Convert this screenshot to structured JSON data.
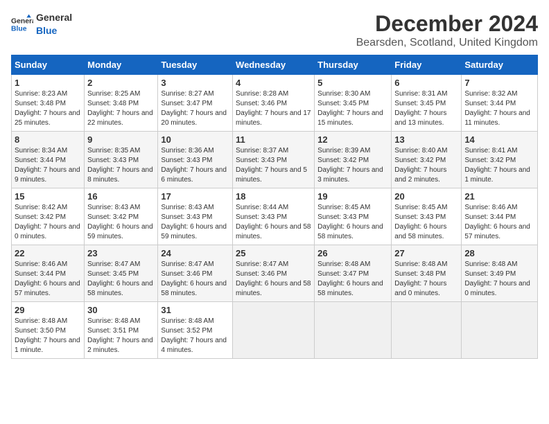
{
  "header": {
    "logo_general": "General",
    "logo_blue": "Blue",
    "title": "December 2024",
    "subtitle": "Bearsden, Scotland, United Kingdom"
  },
  "days_of_week": [
    "Sunday",
    "Monday",
    "Tuesday",
    "Wednesday",
    "Thursday",
    "Friday",
    "Saturday"
  ],
  "weeks": [
    [
      {
        "num": "1",
        "sunrise": "8:23 AM",
        "sunset": "3:48 PM",
        "daylight": "7 hours and 25 minutes."
      },
      {
        "num": "2",
        "sunrise": "8:25 AM",
        "sunset": "3:48 PM",
        "daylight": "7 hours and 22 minutes."
      },
      {
        "num": "3",
        "sunrise": "8:27 AM",
        "sunset": "3:47 PM",
        "daylight": "7 hours and 20 minutes."
      },
      {
        "num": "4",
        "sunrise": "8:28 AM",
        "sunset": "3:46 PM",
        "daylight": "7 hours and 17 minutes."
      },
      {
        "num": "5",
        "sunrise": "8:30 AM",
        "sunset": "3:45 PM",
        "daylight": "7 hours and 15 minutes."
      },
      {
        "num": "6",
        "sunrise": "8:31 AM",
        "sunset": "3:45 PM",
        "daylight": "7 hours and 13 minutes."
      },
      {
        "num": "7",
        "sunrise": "8:32 AM",
        "sunset": "3:44 PM",
        "daylight": "7 hours and 11 minutes."
      }
    ],
    [
      {
        "num": "8",
        "sunrise": "8:34 AM",
        "sunset": "3:44 PM",
        "daylight": "7 hours and 9 minutes."
      },
      {
        "num": "9",
        "sunrise": "8:35 AM",
        "sunset": "3:43 PM",
        "daylight": "7 hours and 8 minutes."
      },
      {
        "num": "10",
        "sunrise": "8:36 AM",
        "sunset": "3:43 PM",
        "daylight": "7 hours and 6 minutes."
      },
      {
        "num": "11",
        "sunrise": "8:37 AM",
        "sunset": "3:43 PM",
        "daylight": "7 hours and 5 minutes."
      },
      {
        "num": "12",
        "sunrise": "8:39 AM",
        "sunset": "3:42 PM",
        "daylight": "7 hours and 3 minutes."
      },
      {
        "num": "13",
        "sunrise": "8:40 AM",
        "sunset": "3:42 PM",
        "daylight": "7 hours and 2 minutes."
      },
      {
        "num": "14",
        "sunrise": "8:41 AM",
        "sunset": "3:42 PM",
        "daylight": "7 hours and 1 minute."
      }
    ],
    [
      {
        "num": "15",
        "sunrise": "8:42 AM",
        "sunset": "3:42 PM",
        "daylight": "7 hours and 0 minutes."
      },
      {
        "num": "16",
        "sunrise": "8:43 AM",
        "sunset": "3:42 PM",
        "daylight": "6 hours and 59 minutes."
      },
      {
        "num": "17",
        "sunrise": "8:43 AM",
        "sunset": "3:43 PM",
        "daylight": "6 hours and 59 minutes."
      },
      {
        "num": "18",
        "sunrise": "8:44 AM",
        "sunset": "3:43 PM",
        "daylight": "6 hours and 58 minutes."
      },
      {
        "num": "19",
        "sunrise": "8:45 AM",
        "sunset": "3:43 PM",
        "daylight": "6 hours and 58 minutes."
      },
      {
        "num": "20",
        "sunrise": "8:45 AM",
        "sunset": "3:43 PM",
        "daylight": "6 hours and 58 minutes."
      },
      {
        "num": "21",
        "sunrise": "8:46 AM",
        "sunset": "3:44 PM",
        "daylight": "6 hours and 57 minutes."
      }
    ],
    [
      {
        "num": "22",
        "sunrise": "8:46 AM",
        "sunset": "3:44 PM",
        "daylight": "6 hours and 57 minutes."
      },
      {
        "num": "23",
        "sunrise": "8:47 AM",
        "sunset": "3:45 PM",
        "daylight": "6 hours and 58 minutes."
      },
      {
        "num": "24",
        "sunrise": "8:47 AM",
        "sunset": "3:46 PM",
        "daylight": "6 hours and 58 minutes."
      },
      {
        "num": "25",
        "sunrise": "8:47 AM",
        "sunset": "3:46 PM",
        "daylight": "6 hours and 58 minutes."
      },
      {
        "num": "26",
        "sunrise": "8:48 AM",
        "sunset": "3:47 PM",
        "daylight": "6 hours and 58 minutes."
      },
      {
        "num": "27",
        "sunrise": "8:48 AM",
        "sunset": "3:48 PM",
        "daylight": "7 hours and 0 minutes."
      },
      {
        "num": "28",
        "sunrise": "8:48 AM",
        "sunset": "3:49 PM",
        "daylight": "7 hours and 0 minutes."
      }
    ],
    [
      {
        "num": "29",
        "sunrise": "8:48 AM",
        "sunset": "3:50 PM",
        "daylight": "7 hours and 1 minute."
      },
      {
        "num": "30",
        "sunrise": "8:48 AM",
        "sunset": "3:51 PM",
        "daylight": "7 hours and 2 minutes."
      },
      {
        "num": "31",
        "sunrise": "8:48 AM",
        "sunset": "3:52 PM",
        "daylight": "7 hours and 4 minutes."
      },
      null,
      null,
      null,
      null
    ]
  ]
}
